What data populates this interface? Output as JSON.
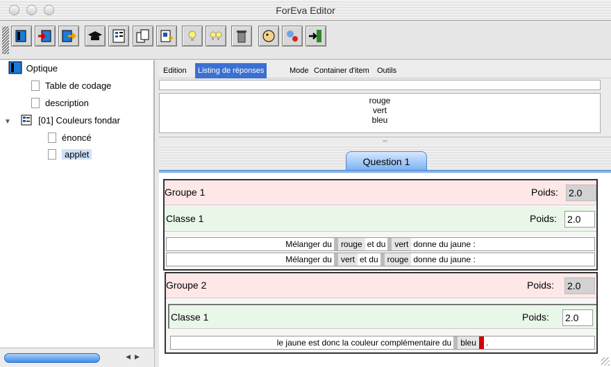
{
  "window": {
    "title": "ForEva Editor"
  },
  "toolbar": {
    "buttons": [
      {
        "icon": "open-book-icon"
      },
      {
        "icon": "book-import-icon"
      },
      {
        "icon": "book-export-icon"
      },
      {
        "icon": "graduation-cap-icon"
      },
      {
        "icon": "list-item-icon"
      },
      {
        "icon": "copy-pages-icon"
      },
      {
        "icon": "paste-pages-icon"
      },
      {
        "icon": "lightbulb-icon"
      },
      {
        "icon": "double-lightbulb-icon"
      },
      {
        "icon": "trash-icon"
      },
      {
        "icon": "head-icon"
      },
      {
        "icon": "tools-icon"
      },
      {
        "icon": "exit-door-icon"
      }
    ]
  },
  "tree": {
    "root": "Optique",
    "items": [
      "Table de codage",
      "description"
    ],
    "folder": "[01] Couleurs fondar",
    "children": [
      "énoncé",
      "applet"
    ]
  },
  "menu": [
    "Edition",
    "Listing de réponses",
    "Mode",
    "Container d'item",
    "Outils"
  ],
  "responses": [
    "rouge",
    "vert",
    "bleu"
  ],
  "tab": {
    "label": "Question 1"
  },
  "groups": [
    {
      "name": "Groupe 1",
      "poids_label": "Poids:",
      "poids": "2.0",
      "classe": {
        "name": "Classe 1",
        "poids_label": "Poids:",
        "poids": "2.0"
      },
      "sentences": [
        {
          "t1": "Mélanger du",
          "w1": "rouge",
          "t2": "et du",
          "w2": "vert",
          "t3": "donne du jaune :"
        },
        {
          "t1": "Mélanger du",
          "w1": "vert",
          "t2": "et du",
          "w2": "rouge",
          "t3": "donne du jaune :"
        }
      ]
    },
    {
      "name": "Groupe 2",
      "poids_label": "Poids:",
      "poids": "2.0",
      "classe": {
        "name": "Classe 1",
        "poids_label": "Poids:",
        "poids": "2.0"
      },
      "sentences": [
        {
          "t1": "le jaune est donc la couleur complémentaire du",
          "w1": "bleu",
          "t2": "."
        }
      ]
    }
  ],
  "colors": {
    "accent": "#3b6fd0",
    "group_bg": "#fde7e7",
    "class_bg": "#e8f7e8",
    "tab": "#7eb2f1"
  }
}
